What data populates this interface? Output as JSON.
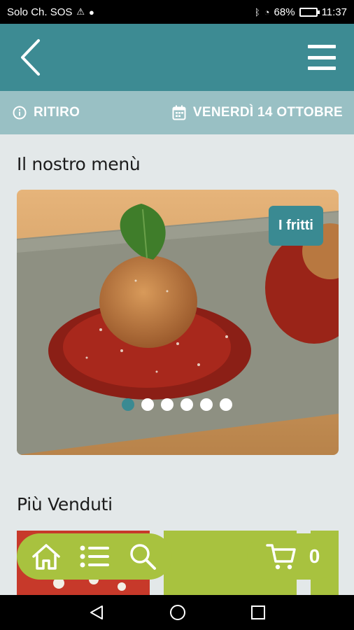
{
  "status_bar": {
    "carrier": "Solo Ch. SOS",
    "battery_percent": "68%",
    "time": "11:37"
  },
  "header": {
    "back_icon": "chevron-left-icon",
    "menu_icon": "hamburger-icon"
  },
  "info_bar": {
    "mode_label": "RITIRO",
    "date_label": "VENERDÌ 14 OTTOBRE"
  },
  "menu_section": {
    "title": "Il nostro menù",
    "slide_category": "I fritti",
    "slides_total": 6,
    "active_slide": 1
  },
  "best_sellers": {
    "title": "Più Venduti"
  },
  "bottom_nav": {
    "cart_count": "0"
  },
  "colors": {
    "accent": "#3d8b93",
    "info_bar": "#99c0c4",
    "pill": "#a8c23f",
    "background": "#e3e8e9"
  }
}
